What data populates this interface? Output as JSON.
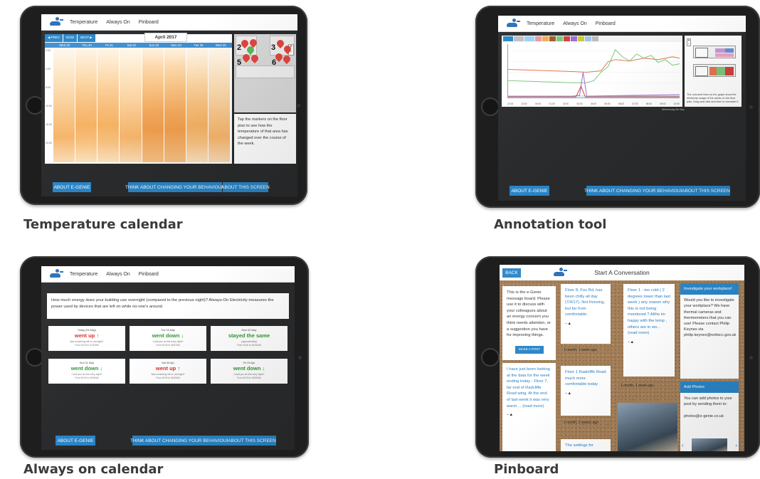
{
  "captions": {
    "temperature": "Temperature calendar",
    "annotation": "Annotation tool",
    "always_on": "Always on calendar",
    "pinboard": "Pinboard"
  },
  "nav": {
    "temperature": "Temperature",
    "always_on": "Always On",
    "pinboard": "Pinboard"
  },
  "buttons": {
    "about": "ABOUT E-GENIE",
    "think": "THINK ABOUT CHANGING YOUR BEHAVIOUR",
    "about_screen": "ABOUT THIS SCREEN"
  },
  "temperature_calendar": {
    "prev": "◀ PREV",
    "now": "NOW",
    "next": "NEXT ▶",
    "month": "April 2017",
    "days": [
      "Wed 19",
      "Thu 20",
      "Fri 21",
      "Sat 22",
      "Sun 23",
      "Mon 24",
      "Tue 25",
      "Wed 26"
    ],
    "times": [
      "0:00",
      "4:00",
      "8:00",
      "12:00",
      "16:00",
      "20:00"
    ],
    "tip": "Tap the markers on the floor plan to see how the temperature of that area has changed over the course of the week.",
    "pins": [
      "2",
      "3",
      "5",
      "6"
    ],
    "zoom_in": "+",
    "zoom_out": "-"
  },
  "annotation_tool": {
    "legend_text": "The coloured lines on the graph show the electricity usage of the areas on the floor plan. Drag and click and then to annotate it.",
    "date_label": "Wednesday 6th May",
    "x_ticks": [
      "22:00",
      "23:00",
      "00:00",
      "01:00",
      "02:00",
      "03:00",
      "04:00",
      "05:00",
      "06:00",
      "07:00",
      "08:00",
      "09:00",
      "10:00"
    ],
    "palette": [
      "#2a86c8",
      "#c0c0c0",
      "#9dd1f0",
      "#e49aa7",
      "#f0ac55",
      "#a05a2c",
      "#7bc67b",
      "#d04040",
      "#9c6fd0",
      "#c9c93a",
      "#9ec3e6",
      "#bbbbbb"
    ]
  },
  "always_on": {
    "question": "How much energy does your building use overnight (compared to the previous night)? Always-On Electricity measures the power used by devices that are left on while no-one's around.",
    "cards": [
      {
        "day": "Today (04 May)",
        "status": "went up",
        "dir": "up",
        "q": "Was something left on overnight?",
        "range": "From 00:00 to 07:00AM"
      },
      {
        "day": "Tue 03 May",
        "status": "went down",
        "dir": "down",
        "q": "Could you do this every night?",
        "range": "From 00:00 to 06:57AM"
      },
      {
        "day": "Mon 02 May",
        "status": "stayed the same",
        "dir": "down",
        "q": "(approximately)",
        "range": "From 00:00 to 06:58 AM"
      },
      {
        "day": "Sun 01 May",
        "status": "went down",
        "dir": "down",
        "q": "Could you do this every night?",
        "range": "From 00:00 to 06:59AM"
      },
      {
        "day": "Sat 30 Apr",
        "status": "went up",
        "dir": "up",
        "q": "Was something left on overnight?",
        "range": "From 00:00 to 06:59AM"
      },
      {
        "day": "Fri 29 Apr",
        "status": "went down",
        "dir": "down",
        "q": "Could you do this every night?",
        "range": "From 00:00 to 06:59AM"
      }
    ]
  },
  "pinboard": {
    "back": "BACK",
    "title": "Start A Conversation",
    "intro": "This is the e-Genie message board. Please use it to discuss with your colleagues about an energy concern you think needs attention, or a suggestion you have for improving things.",
    "make_post": "MAKE A POST",
    "notes": [
      {
        "text": "Floor 8, Fox Rd, has been chilly all day (7/4/17). Not freezing, but far from comfortable.",
        "meta": "1 month, 1 week ago"
      },
      {
        "text": "Floor 1 - too cold ( 2 degrees lower than last week ) any reason why this is not being monitored ? Altho im happy with the temp , others are in wo... (read more)",
        "meta": "1 month, 1 week ago"
      },
      {
        "text": "I have just been looking at the data for the week ending today - Floor 7, far end of Radcliffe Road wing. At the end of last week it was very warm ... (read more)",
        "meta": ""
      },
      {
        "text": "Floor 1 Radcliffe Road much more comfortable today",
        "meta": "1 month, 2 weeks ago"
      },
      {
        "text": "The settings for",
        "meta": ""
      }
    ],
    "investigate_title": "Investigate your workplace!",
    "investigate_body": "Would you like to investigate your workplace? We have thermal cameras and thermometers that you can use! Please contact Philip Keynes via philip.keynes@nottscc.gov.uk",
    "photos_title": "Add Photos",
    "photos_body": "You can add photos to your post by sending them to:",
    "photos_email": "photos@e-genie.co.uk"
  }
}
